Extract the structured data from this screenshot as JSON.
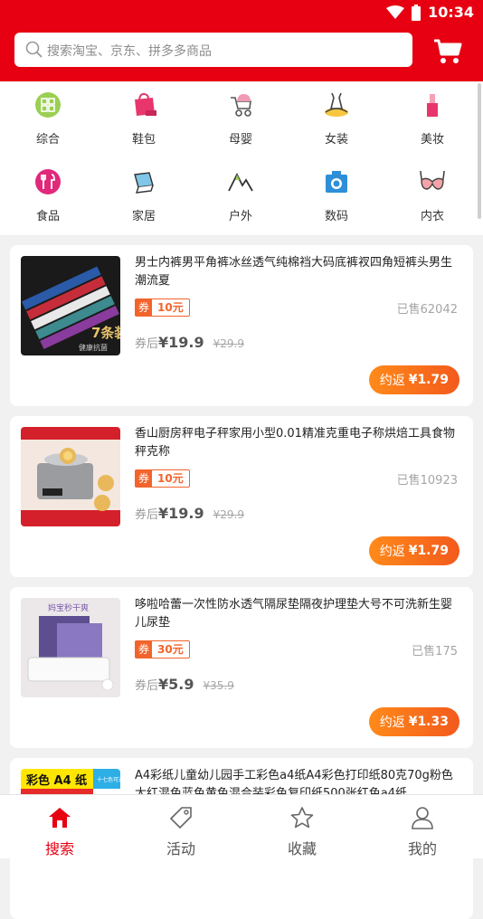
{
  "statusbar": {
    "time": "10:34"
  },
  "search": {
    "placeholder": "搜索淘宝、京东、拼多多商品"
  },
  "categories": [
    {
      "label": "综合",
      "icon": "grid-icon"
    },
    {
      "label": "鞋包",
      "icon": "bag-icon"
    },
    {
      "label": "母婴",
      "icon": "stroller-icon"
    },
    {
      "label": "女装",
      "icon": "dress-icon"
    },
    {
      "label": "美妆",
      "icon": "lipstick-icon"
    },
    {
      "label": "食品",
      "icon": "food-icon"
    },
    {
      "label": "家居",
      "icon": "home-icon"
    },
    {
      "label": "户外",
      "icon": "mountain-icon"
    },
    {
      "label": "数码",
      "icon": "camera-icon"
    },
    {
      "label": "内衣",
      "icon": "bra-icon"
    }
  ],
  "products": [
    {
      "title": "男士内裤男平角裤冰丝透气纯棉裆大码底裤衩四角短裤头男生潮流夏",
      "coupon_label": "券",
      "coupon_value": "10元",
      "sold": "已售62042",
      "price_label": "券后",
      "price": "¥19.9",
      "original_price": "¥29.9",
      "rebate_label": "约返",
      "rebate_value": "¥1.79"
    },
    {
      "title": "香山厨房秤电子秤家用小型0.01精准克重电子称烘焙工具食物秤克称",
      "coupon_label": "券",
      "coupon_value": "10元",
      "sold": "已售10923",
      "price_label": "券后",
      "price": "¥19.9",
      "original_price": "¥29.9",
      "rebate_label": "约返",
      "rebate_value": "¥1.79"
    },
    {
      "title": "哆啦哈蕾一次性防水透气隔尿垫隔夜护理垫大号不可洗新生婴儿尿垫",
      "coupon_label": "券",
      "coupon_value": "30元",
      "sold": "已售175",
      "price_label": "券后",
      "price": "¥5.9",
      "original_price": "¥35.9",
      "rebate_label": "约返",
      "rebate_value": "¥1.33"
    },
    {
      "title": "A4彩纸儿童幼儿园手工彩色a4纸A4彩色打印纸80克70g粉色大红混色蓝色黄色混合装彩色复印纸500张红色a4纸"
    }
  ],
  "thumbs": [
    "7条装",
    "健康抗菌",
    "妈宝秒干爽",
    "彩色 A4 纸",
    "十七色可选"
  ],
  "tabbar": [
    {
      "label": "搜索",
      "icon": "home-icon",
      "active": true
    },
    {
      "label": "活动",
      "icon": "tag-icon"
    },
    {
      "label": "收藏",
      "icon": "star-icon"
    },
    {
      "label": "我的",
      "icon": "user-icon"
    }
  ],
  "colors": {
    "brand": "#e60012",
    "accent": "#f2642c"
  }
}
